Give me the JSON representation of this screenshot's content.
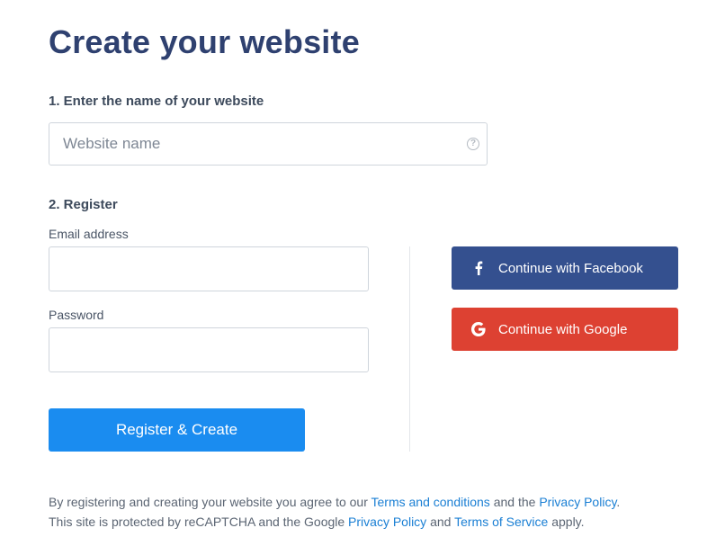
{
  "page": {
    "title": "Create your website"
  },
  "step1": {
    "heading": "1. Enter the name of your website",
    "website_placeholder": "Website name",
    "help_icon": "question-circle-icon",
    "help_glyph": "?"
  },
  "step2": {
    "heading": "2. Register",
    "email_label": "Email address",
    "email_value": "",
    "password_label": "Password",
    "password_value": "",
    "register_label": "Register & Create"
  },
  "social": {
    "facebook_label": "Continue with Facebook",
    "facebook_icon": "facebook-icon",
    "google_label": "Continue with Google",
    "google_icon": "google-icon"
  },
  "legal": {
    "line1_prefix": "By registering and creating your website you agree to our ",
    "terms_conditions": "Terms and conditions",
    "line1_middle": " and the ",
    "privacy_policy_1": "Privacy Policy",
    "line1_suffix": ".",
    "line2_prefix": "This site is protected by reCAPTCHA and the Google ",
    "privacy_policy_2": "Privacy Policy",
    "line2_middle": " and ",
    "terms_of_service": "Terms of Service",
    "line2_suffix": " apply."
  },
  "colors": {
    "title": "#2f4170",
    "primary": "#1a8cf0",
    "facebook": "#34508f",
    "google": "#dd4132",
    "link": "#1a7fd4"
  }
}
